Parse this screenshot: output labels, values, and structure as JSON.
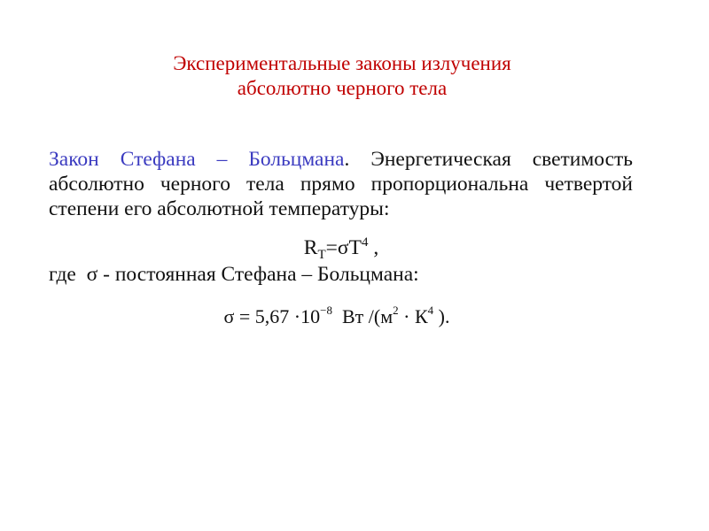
{
  "slide": {
    "title_line1": "Экспериментальные законы излучения",
    "title_line2": "абсолютно черного тела",
    "law_name": "Закон Стефана – Больцмана",
    "law_period": ".",
    "law_text": " Энергетическая светимость абсолютно черного тела прямо пропорциональна четвертой степени его абсолютной температуры:",
    "formula1": {
      "R": "R",
      "sub": "T",
      "middle": "=σT",
      "exp": "4",
      "tail": " ,"
    },
    "where_text": "где  σ - постоянная Стефана – Больцмана:",
    "formula2": {
      "lhs": "σ = 5,67 ·10",
      "exp": "−8",
      "unit_start": "  Вт /(м",
      "exp2": "2",
      "unit_mid": " · К",
      "exp3": "4",
      "unit_end": " )."
    },
    "colors": {
      "title": "#c00000",
      "accent": "#3b3bc0",
      "text": "#111111"
    }
  }
}
